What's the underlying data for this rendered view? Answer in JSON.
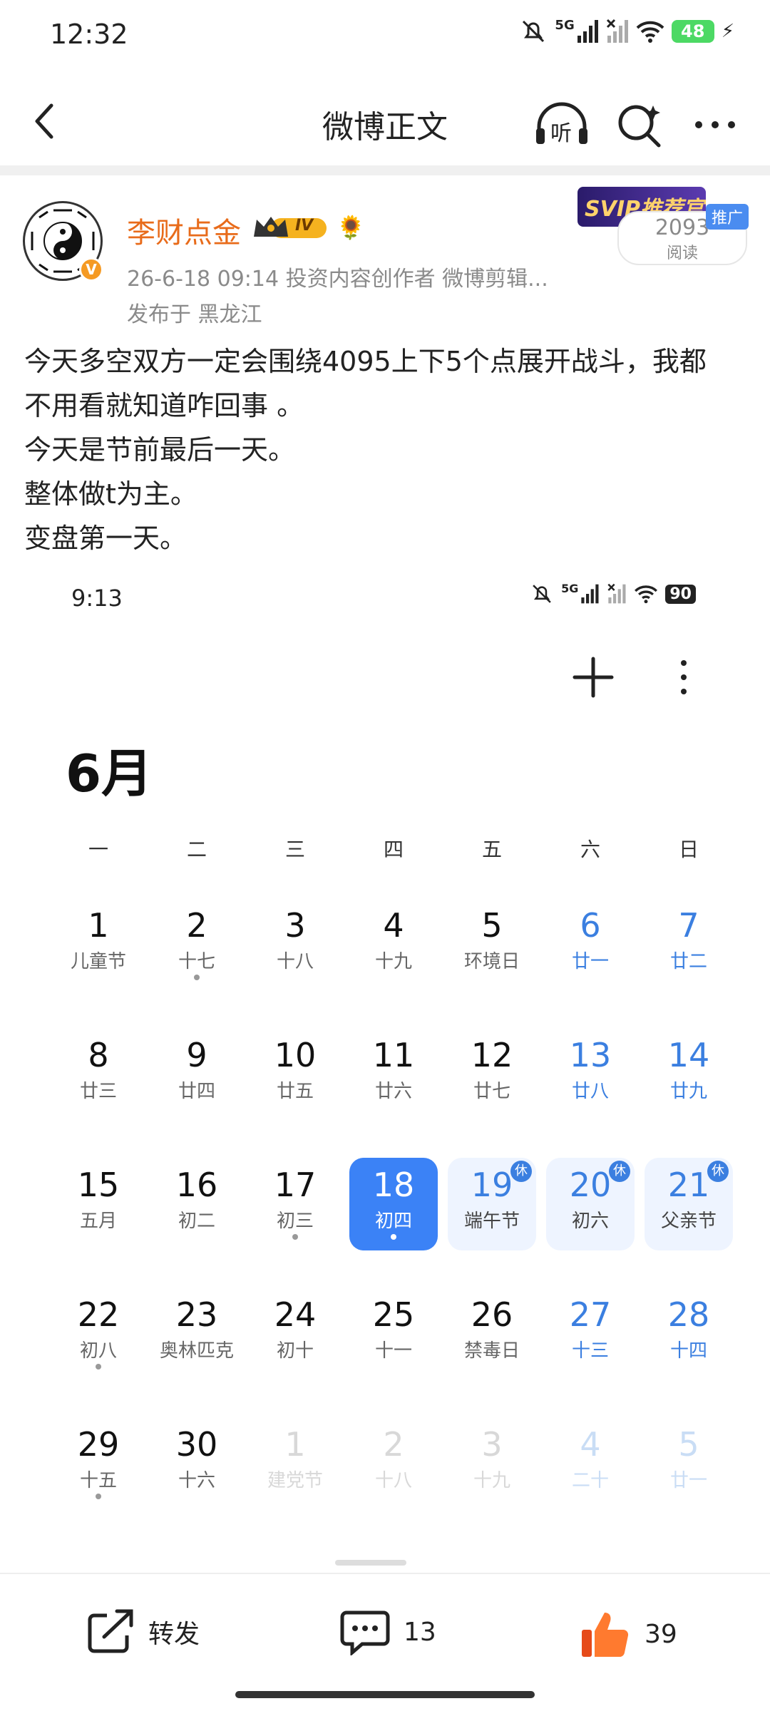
{
  "status_bar": {
    "time": "12:32",
    "network": "5G",
    "battery": "48"
  },
  "header": {
    "title": "微博正文",
    "listen_label": "听"
  },
  "post": {
    "author": "李财点金",
    "level_badge": "IV",
    "meta": "26-6-18 09:14  投资内容创作者 微博剪辑...",
    "location": "发布于 黑龙江",
    "promo": "SVIP推荐官",
    "promo_tag": "推广",
    "read_count": "2093",
    "read_label": "阅读",
    "lines": [
      "今天多空双方一定会围绕4095上下5个点展开战斗，我都",
      "不用看就知道咋回事 。",
      "今天是节前最后一天。",
      "整体做t为主。",
      "变盘第一天。"
    ]
  },
  "screenshot": {
    "time": "9:13",
    "network": "5G",
    "battery": "90",
    "month": "6月",
    "weekdays": [
      "一",
      "二",
      "三",
      "四",
      "五",
      "六",
      "日"
    ],
    "holiday_mark": "休",
    "rows": [
      [
        {
          "d": "1",
          "l": "儿童节"
        },
        {
          "d": "2",
          "l": "十七",
          "dot": true
        },
        {
          "d": "3",
          "l": "十八"
        },
        {
          "d": "4",
          "l": "十九"
        },
        {
          "d": "5",
          "l": "环境日"
        },
        {
          "d": "6",
          "l": "廿一",
          "blue": true
        },
        {
          "d": "7",
          "l": "廿二",
          "blue": true
        }
      ],
      [
        {
          "d": "8",
          "l": "廿三"
        },
        {
          "d": "9",
          "l": "廿四"
        },
        {
          "d": "10",
          "l": "廿五"
        },
        {
          "d": "11",
          "l": "廿六"
        },
        {
          "d": "12",
          "l": "廿七"
        },
        {
          "d": "13",
          "l": "廿八",
          "blue": true
        },
        {
          "d": "14",
          "l": "廿九",
          "blue": true
        }
      ],
      [
        {
          "d": "15",
          "l": "五月"
        },
        {
          "d": "16",
          "l": "初二"
        },
        {
          "d": "17",
          "l": "初三",
          "dot": true
        },
        {
          "d": "18",
          "l": "初四",
          "today": true,
          "dot": true
        },
        {
          "d": "19",
          "l": "端午节",
          "hol": true
        },
        {
          "d": "20",
          "l": "初六",
          "hol": true
        },
        {
          "d": "21",
          "l": "父亲节",
          "hol": true
        }
      ],
      [
        {
          "d": "22",
          "l": "初八",
          "dot": true
        },
        {
          "d": "23",
          "l": "奥林匹克"
        },
        {
          "d": "24",
          "l": "初十"
        },
        {
          "d": "25",
          "l": "十一"
        },
        {
          "d": "26",
          "l": "禁毒日"
        },
        {
          "d": "27",
          "l": "十三",
          "blue": true
        },
        {
          "d": "28",
          "l": "十四",
          "blue": true
        }
      ],
      [
        {
          "d": "29",
          "l": "十五",
          "dot": true
        },
        {
          "d": "30",
          "l": "十六"
        },
        {
          "d": "1",
          "l": "建党节",
          "faded": true
        },
        {
          "d": "2",
          "l": "十八",
          "faded": true
        },
        {
          "d": "3",
          "l": "十九",
          "faded": true
        },
        {
          "d": "4",
          "l": "二十",
          "faded": true,
          "blue": true
        },
        {
          "d": "5",
          "l": "廿一",
          "faded": true,
          "blue": true
        }
      ]
    ]
  },
  "actions": {
    "repost": "转发",
    "comments": "13",
    "likes": "39"
  }
}
